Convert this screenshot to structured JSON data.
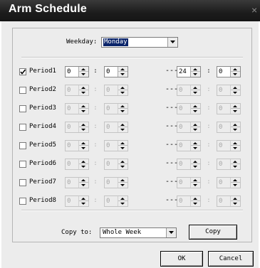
{
  "window": {
    "title": "Arm Schedule",
    "close_glyph": "×"
  },
  "weekday": {
    "label": "Weekday:",
    "value": "Monday"
  },
  "periods": [
    {
      "label": "Period1",
      "checked": true,
      "start_hour": "0",
      "start_min": "0",
      "end_hour": "24",
      "end_min": "0"
    },
    {
      "label": "Period2",
      "checked": false,
      "start_hour": "0",
      "start_min": "0",
      "end_hour": "0",
      "end_min": "0"
    },
    {
      "label": "Period3",
      "checked": false,
      "start_hour": "0",
      "start_min": "0",
      "end_hour": "0",
      "end_min": "0"
    },
    {
      "label": "Period4",
      "checked": false,
      "start_hour": "0",
      "start_min": "0",
      "end_hour": "0",
      "end_min": "0"
    },
    {
      "label": "Period5",
      "checked": false,
      "start_hour": "0",
      "start_min": "0",
      "end_hour": "0",
      "end_min": "0"
    },
    {
      "label": "Period6",
      "checked": false,
      "start_hour": "0",
      "start_min": "0",
      "end_hour": "0",
      "end_min": "0"
    },
    {
      "label": "Period7",
      "checked": false,
      "start_hour": "0",
      "start_min": "0",
      "end_hour": "0",
      "end_min": "0"
    },
    {
      "label": "Period8",
      "checked": false,
      "start_hour": "0",
      "start_min": "0",
      "end_hour": "0",
      "end_min": "0"
    }
  ],
  "time_separator": ":",
  "range_separator": "---",
  "copy": {
    "label": "Copy to:",
    "value": "Whole Week",
    "button": "Copy"
  },
  "buttons": {
    "ok": "OK",
    "cancel": "Cancel"
  }
}
